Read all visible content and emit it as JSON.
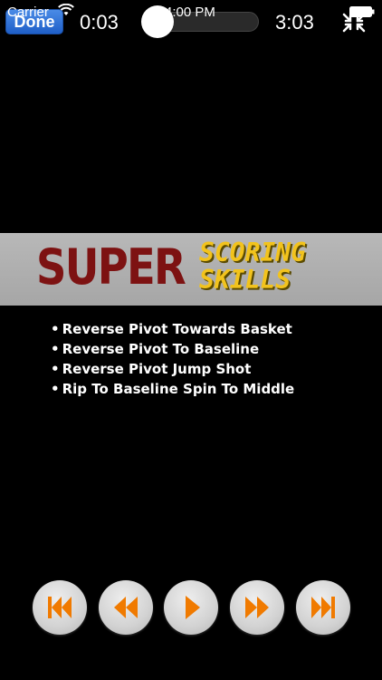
{
  "status_bar": {
    "carrier": "Carrier",
    "time": "4:00 PM"
  },
  "player": {
    "done_label": "Done",
    "elapsed": "0:03",
    "remaining": "3:03",
    "progress": 0.0
  },
  "video": {
    "banner_super": "SUPER",
    "banner_scoring": "SCORING",
    "banner_skills": "SKILLS",
    "bullet_char": "•",
    "bullets": [
      "Reverse Pivot Towards Basket",
      "Reverse Pivot To Baseline",
      "Reverse Pivot Jump Shot",
      "Rip To Baseline Spin To Middle"
    ]
  },
  "controls": [
    {
      "icon": "skip-to-start-icon"
    },
    {
      "icon": "rewind-icon"
    },
    {
      "icon": "play-icon"
    },
    {
      "icon": "fast-forward-icon"
    },
    {
      "icon": "skip-to-end-icon"
    }
  ],
  "colors": {
    "control_icon": "#f07a00",
    "banner_super": "#7d1212",
    "banner_scoring": "#f2c31d",
    "done_button": "#2f6fd6"
  }
}
